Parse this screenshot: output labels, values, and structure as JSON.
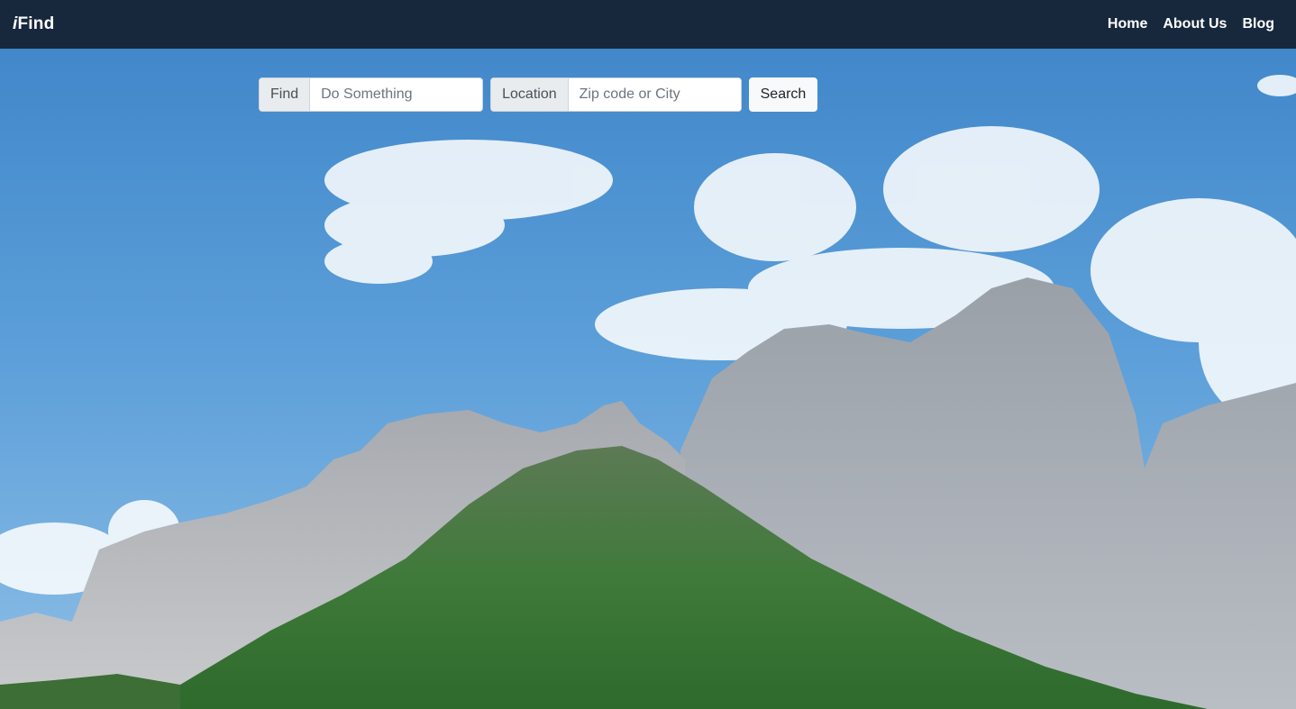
{
  "navbar": {
    "brand_prefix": "i",
    "brand_suffix": "Find",
    "links": [
      "Home",
      "About Us",
      "Blog"
    ]
  },
  "search": {
    "find_label": "Find",
    "find_placeholder": "Do Something",
    "location_label": "Location",
    "location_placeholder": "Zip code or City",
    "button_label": "Search"
  },
  "colors": {
    "navbar_bg": "#142030",
    "sky": "#5b9fd8"
  }
}
